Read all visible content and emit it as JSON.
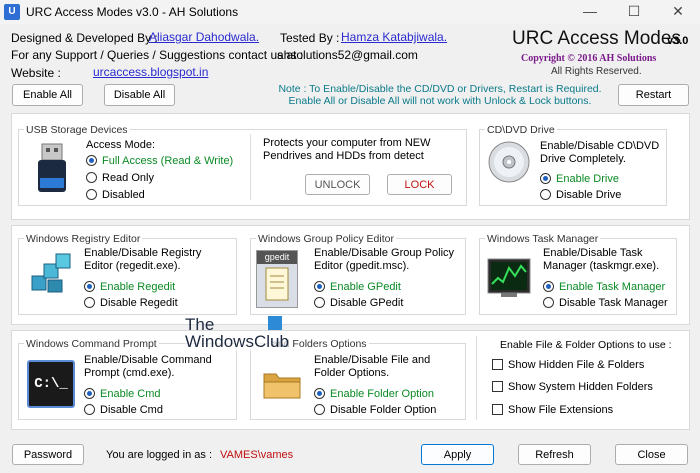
{
  "window": {
    "title": "URC Access Modes v3.0 - AH Solutions",
    "minimize": "—",
    "maximize": "☐",
    "close": "✕"
  },
  "header": {
    "designed_label": "Designed & Developed By :",
    "designer": "Aliasgar Dahodwala.",
    "tested_label": "Tested By :",
    "tester": "Hamza Katabjiwala.",
    "support_label": "For any Support / Queries / Suggestions contact us at :",
    "support_email": "ahsolutions52@gmail.com",
    "website_label": "Website :",
    "website": "urcaccess.blogspot.in",
    "app_name": "URC Access Modes",
    "version": "v3.0",
    "copyright": "Copyright © 2016 AH Solutions",
    "rights": "All Rights Reserved."
  },
  "toolbar": {
    "enable_all": "Enable All",
    "disable_all": "Disable All",
    "note_line1": "Note :  To Enable/Disable the CD/DVD or Drivers, Restart is Required.",
    "note_line2": "Enable All or Disable All will not work with Unlock & Lock buttons.",
    "restart": "Restart"
  },
  "usb": {
    "title": "USB Storage Devices",
    "mode_label": "Access Mode:",
    "opt_full": "Full Access (Read & Write)",
    "opt_read": "Read Only",
    "opt_disabled": "Disabled",
    "protect_text": "Protects your computer from NEW Pendrives and HDDs from detect",
    "unlock": "UNLOCK",
    "lock": "LOCK"
  },
  "cddvd": {
    "title": "CD\\DVD Drive",
    "desc": "Enable/Disable CD\\DVD Drive Completely.",
    "enable": "Enable Drive",
    "disable": "Disable Drive"
  },
  "registry": {
    "title": "Windows Registry Editor",
    "desc": "Enable/Disable Registry Editor (regedit.exe).",
    "enable": "Enable Regedit",
    "disable": "Disable Regedit"
  },
  "gpedit": {
    "title": "Windows Group Policy Editor",
    "icon_label": "gpedit",
    "desc": "Enable/Disable Group Policy Editor (gpedit.msc).",
    "enable": "Enable GPedit",
    "disable": "Disable GPedit"
  },
  "taskmgr": {
    "title": "Windows Task Manager",
    "desc": "Enable/Disable Task Manager (taskmgr.exe).",
    "enable": "Enable Task Manager",
    "disable": "Disable Task Manager"
  },
  "cmd": {
    "title": "Windows Command Prompt",
    "icon_label": "C:\\_",
    "desc": "Enable/Disable Command Prompt (cmd.exe).",
    "enable": "Enable Cmd",
    "disable": "Disable Cmd"
  },
  "folderopts": {
    "title": "and Folders Options",
    "desc": "Enable/Disable File and Folder Options.",
    "enable": "Enable Folder Option",
    "disable": "Disable Folder Option"
  },
  "fileopts": {
    "title": "Enable File & Folder Options to use :",
    "opt1": "Show Hidden File & Folders",
    "opt2": "Show System Hidden Folders",
    "opt3": "Show File Extensions"
  },
  "watermark": {
    "line1": "The",
    "line2": "WindowsClub"
  },
  "footer": {
    "password": "Password",
    "logged_label": "You are logged in as :",
    "user": "VAMES\\vames",
    "apply": "Apply",
    "refresh": "Refresh",
    "close": "Close"
  },
  "colors": {
    "accent": "#0078d7",
    "green": "#0a8a24",
    "link": "#2a2ad0",
    "user": "#c01010",
    "note": "#0a7a8a"
  }
}
